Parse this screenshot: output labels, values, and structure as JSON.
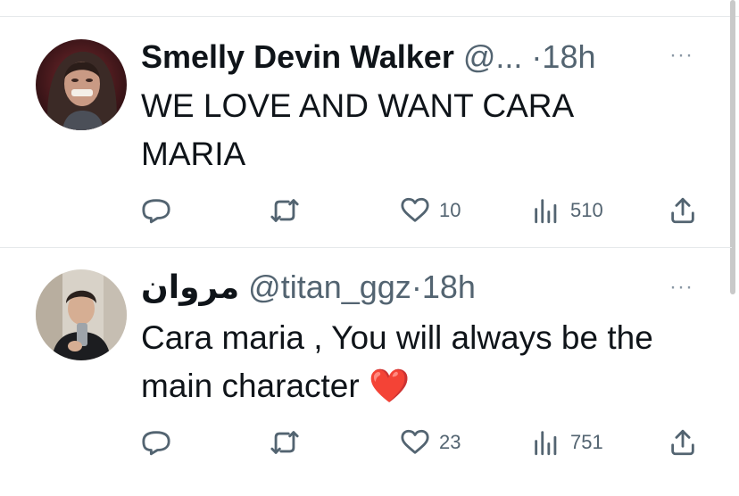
{
  "tweets": [
    {
      "display_name": "Smelly Devin Walker",
      "handle": "@...",
      "time": "18h",
      "text": "WE LOVE AND WANT CARA MARIA",
      "reply_count": "",
      "retweet_count": "",
      "like_count": "10",
      "view_count": "510"
    },
    {
      "display_name": "مروان",
      "handle": "@titan_ggz",
      "time": "18h",
      "text": "Cara maria , You will always be the main character ❤️",
      "reply_count": "",
      "retweet_count": "",
      "like_count": "23",
      "view_count": "751"
    }
  ],
  "icons": {
    "more": "more-icon",
    "reply": "reply-icon",
    "retweet": "retweet-icon",
    "like": "heart-icon",
    "views": "views-icon",
    "share": "share-icon"
  },
  "separator": "·",
  "more_glyph": "···",
  "colors": {
    "text": "#0f1419",
    "secondary": "#536471",
    "divider": "#e6e9eb"
  }
}
